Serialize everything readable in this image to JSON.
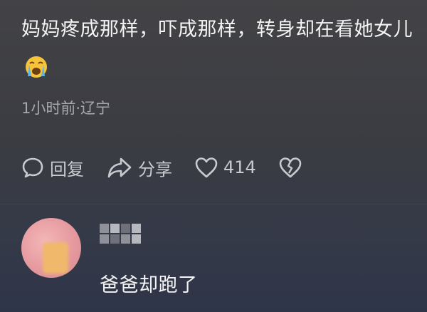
{
  "comment": {
    "text": "妈妈疼成那样，吓成那样，转身却在看她女儿",
    "emoji": "loudly-crying-face-icon",
    "meta": "1小时前·辽宁"
  },
  "actions": {
    "reply_label": "回复",
    "share_label": "分享",
    "like_count": "414"
  },
  "reply": {
    "text": "爸爸却跑了"
  },
  "colors": {
    "background_top": "#434346",
    "background_bottom": "#2e3548",
    "text": "#f4f4f4",
    "meta": "#a7a8ad",
    "emoji_face": "#f6c33a",
    "emoji_tears": "#5bb6e8"
  }
}
